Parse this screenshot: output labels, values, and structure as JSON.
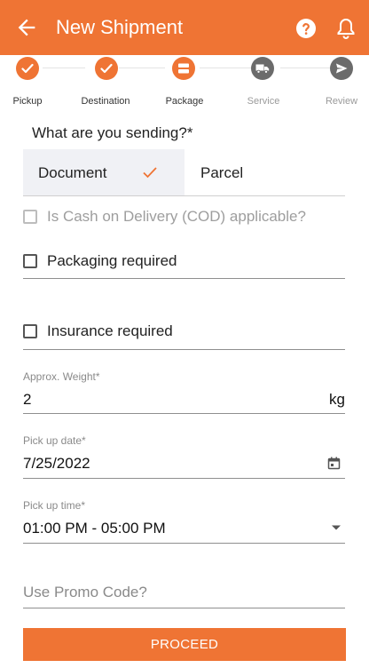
{
  "header": {
    "title": "New Shipment",
    "back_icon": "arrow-left-icon",
    "help_icon": "help-circle-icon",
    "bell_icon": "bell-icon"
  },
  "stepper": {
    "steps": [
      {
        "label": "Pickup",
        "state": "done"
      },
      {
        "label": "Destination",
        "state": "done"
      },
      {
        "label": "Package",
        "state": "current"
      },
      {
        "label": "Service",
        "state": "pending"
      },
      {
        "label": "Review",
        "state": "pending"
      }
    ]
  },
  "form": {
    "question": "What are you sending?*",
    "type_options": [
      {
        "label": "Document",
        "selected": true
      },
      {
        "label": "Parcel",
        "selected": false
      }
    ],
    "cod_label": "Is Cash on Delivery (COD) applicable?",
    "packaging_label": "Packaging required",
    "insurance_label": "Insurance required",
    "weight": {
      "label": "Approx. Weight*",
      "value": "2",
      "unit": "kg"
    },
    "pickup_date": {
      "label": "Pick up date*",
      "value": "7/25/2022"
    },
    "pickup_time": {
      "label": "Pick up time*",
      "value": "01:00 PM - 05:00 PM"
    },
    "promo": {
      "placeholder": "Use Promo Code?"
    },
    "proceed_label": "PROCEED"
  },
  "colors": {
    "accent": "#ef7434",
    "done": "#ef7434",
    "pending": "#6b6b6b"
  }
}
